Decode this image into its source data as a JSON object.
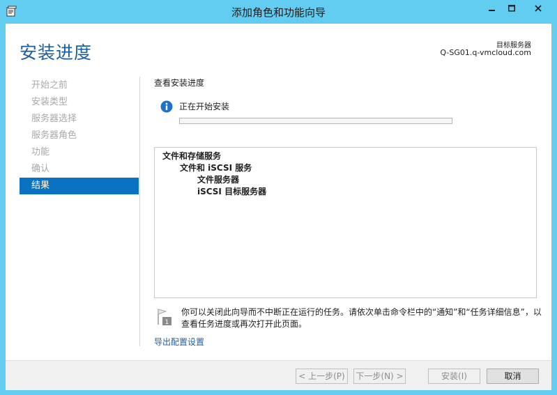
{
  "window": {
    "title": "添加角色和功能向导",
    "app_icon": "wizard-app-icon",
    "controls": [
      "minimize-icon",
      "maximize-icon",
      "close-icon"
    ]
  },
  "header": {
    "page_title": "安装进度",
    "server_label": "目标服务器",
    "server_name": "Q-SG01.q-vmcloud.com"
  },
  "nav": {
    "items": [
      {
        "label": "开始之前",
        "active": false
      },
      {
        "label": "安装类型",
        "active": false
      },
      {
        "label": "服务器选择",
        "active": false
      },
      {
        "label": "服务器角色",
        "active": false
      },
      {
        "label": "功能",
        "active": false
      },
      {
        "label": "确认",
        "active": false
      },
      {
        "label": "结果",
        "active": true
      }
    ]
  },
  "main": {
    "section_heading": "查看安装进度",
    "status_text": "正在开始安装",
    "progress_value": 0,
    "features": [
      {
        "label": "文件和存储服务",
        "level": 0
      },
      {
        "label": "文件和 iSCSI 服务",
        "level": 1
      },
      {
        "label": "文件服务器",
        "level": 2
      },
      {
        "label": "iSCSI 目标服务器",
        "level": 2
      }
    ],
    "notice_text": "你可以关闭此向导而不中断正在运行的任务。请依次单击命令栏中的“通知”和“任务详细信息”，以查看任务进度或再次打开此页面。",
    "export_link": "导出配置设置"
  },
  "footer": {
    "prev_label": "< 上一步(P)",
    "next_label": "下一步(N) >",
    "install_label": "安装(I)",
    "cancel_label": "取消"
  },
  "colors": {
    "titlebar": "#62cdf0",
    "accent": "#1b5e9e",
    "nav_active": "#0a72c2",
    "info_icon": "#1e73c8"
  }
}
